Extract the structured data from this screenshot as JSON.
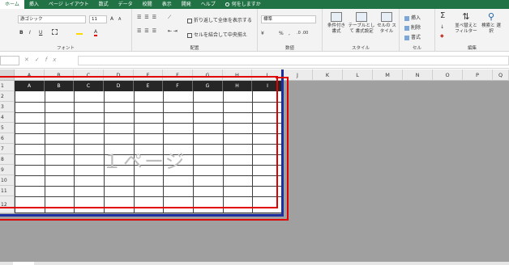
{
  "ribbon_tabs": [
    {
      "label": "ホーム",
      "active": true
    },
    {
      "label": "挿入"
    },
    {
      "label": "ページ レイアウト"
    },
    {
      "label": "数式"
    },
    {
      "label": "データ"
    },
    {
      "label": "校閲"
    },
    {
      "label": "表示"
    },
    {
      "label": "開発"
    },
    {
      "label": "ヘルプ"
    },
    {
      "label": "何をしますか"
    }
  ],
  "font": {
    "name": "游ゴシック",
    "size": "11",
    "group_label": "フォント",
    "bold": "B",
    "italic": "I",
    "underline": "U",
    "grow": "A",
    "shrink": "A",
    "font_color": "A"
  },
  "alignment": {
    "wrap_text": "折り返して全体を表示する",
    "merge_center": "セルを結合して中央揃え",
    "group_label": "配置"
  },
  "number": {
    "format": "標準",
    "percent": "%",
    "comma": ",",
    "group_label": "数値"
  },
  "styles": {
    "conditional": "条件付き 書式",
    "as_table": "テーブルとして 書式設定",
    "cell_styles": "セルの スタイル",
    "group_label": "スタイル"
  },
  "cells": {
    "insert": "挿入",
    "delete": "削除",
    "format": "書式",
    "group_label": "セル"
  },
  "editing": {
    "sum": "Σ",
    "sort_filter": "並べ替えと フィルター",
    "find_select": "検索と 選択",
    "group_label": "編集"
  },
  "formula_bar": {
    "cancel": "✕",
    "enter": "✓",
    "fx": "fx",
    "value": ""
  },
  "sheet": {
    "column_headers": [
      "A",
      "B",
      "C",
      "D",
      "E",
      "F",
      "G",
      "H",
      "I",
      "J",
      "K",
      "L",
      "M",
      "N",
      "O",
      "P",
      "Q"
    ],
    "row_numbers": [
      "1",
      "2",
      "3",
      "4",
      "5",
      "6",
      "7",
      "8",
      "9",
      "10",
      "11",
      "12"
    ],
    "table_headers": [
      "A",
      "B",
      "C",
      "D",
      "E",
      "F",
      "G",
      "H",
      "I"
    ],
    "page_watermark": "１ページ"
  },
  "colors": {
    "ribbon_green": "#217346",
    "page_break_blue": "#1d2ea0",
    "annotation_red": "#e00000",
    "header_fill": "#262626"
  }
}
